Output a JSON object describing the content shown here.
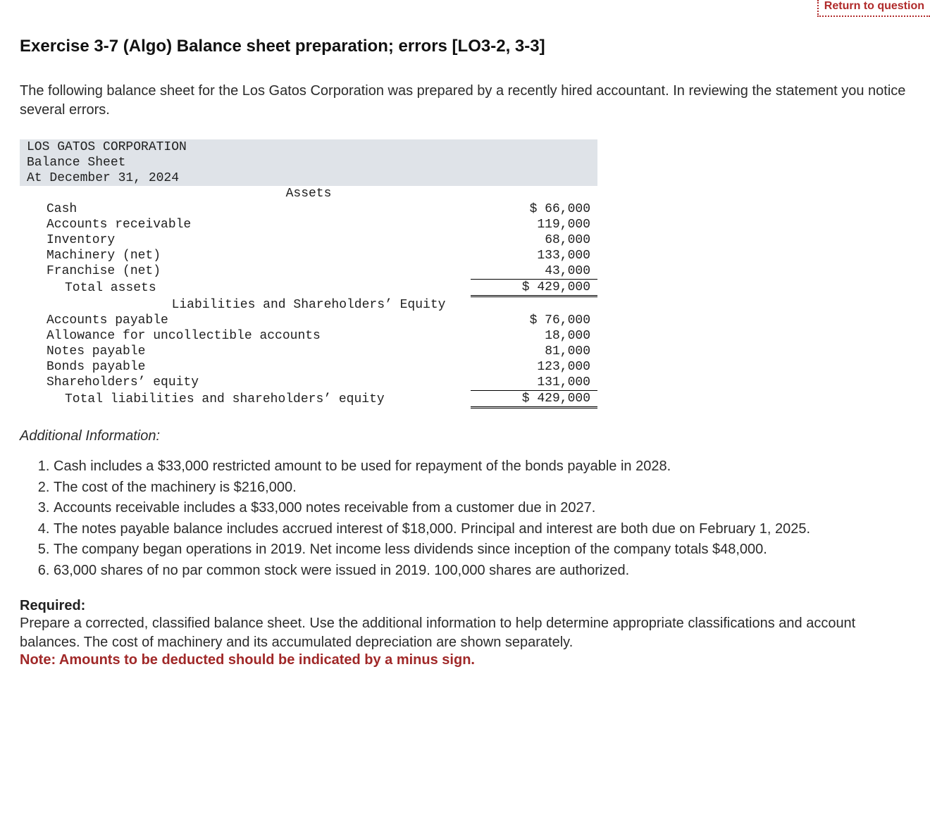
{
  "topButton": {
    "label": "Return to question"
  },
  "title": "Exercise 3-7 (Algo) Balance sheet preparation; errors [LO3-2, 3-3]",
  "intro": "The following balance sheet for the Los Gatos Corporation was prepared by a recently hired accountant. In reviewing the statement you notice several errors.",
  "balanceSheet": {
    "company": "LOS GATOS CORPORATION",
    "statement": "Balance Sheet",
    "date": "At December 31, 2024",
    "assetsHeading": "Assets",
    "assets": [
      {
        "label": "Cash",
        "amount": "$ 66,000"
      },
      {
        "label": "Accounts receivable",
        "amount": "119,000"
      },
      {
        "label": "Inventory",
        "amount": "68,000"
      },
      {
        "label": "Machinery (net)",
        "amount": "133,000"
      },
      {
        "label": "Franchise (net)",
        "amount": "43,000"
      }
    ],
    "totalAssets": {
      "label": "Total assets",
      "amount": "$ 429,000"
    },
    "liabHeading": "Liabilities and Shareholders’ Equity",
    "liab": [
      {
        "label": "Accounts payable",
        "amount": "$ 76,000"
      },
      {
        "label": "Allowance for uncollectible accounts",
        "amount": "18,000"
      },
      {
        "label": "Notes payable",
        "amount": "81,000"
      },
      {
        "label": "Bonds payable",
        "amount": "123,000"
      },
      {
        "label": "Shareholders’ equity",
        "amount": "131,000"
      }
    ],
    "totalLiab": {
      "label": "Total liabilities and shareholders’ equity",
      "amount": "$ 429,000"
    }
  },
  "additionalInfo": {
    "heading": "Additional Information:",
    "items": [
      "Cash includes a $33,000 restricted amount to be used for repayment of the bonds payable in 2028.",
      "The cost of the machinery is $216,000.",
      "Accounts receivable includes a $33,000 notes receivable from a customer due in 2027.",
      "The notes payable balance includes accrued interest of $18,000. Principal and interest are both due on February 1, 2025.",
      "The company began operations in 2019. Net income less dividends since inception of the company totals $48,000.",
      "63,000 shares of no par common stock were issued in 2019. 100,000 shares are authorized."
    ]
  },
  "required": {
    "label": "Required:",
    "body": "Prepare a corrected, classified balance sheet. Use the additional information to help determine appropriate classifications and account balances. The cost of machinery and its accumulated depreciation are shown separately.",
    "note": "Note: Amounts to be deducted should be indicated by a minus sign."
  }
}
